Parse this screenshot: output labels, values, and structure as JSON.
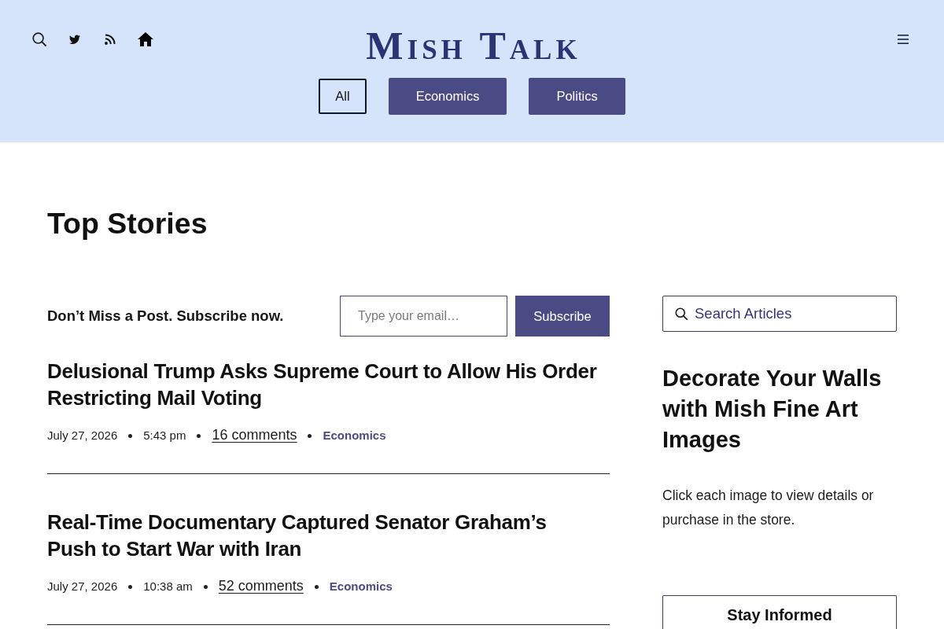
{
  "site": {
    "logo": "Mish Talk"
  },
  "nav": [
    {
      "label": "All",
      "selected": true
    },
    {
      "label": "Economics",
      "selected": false
    },
    {
      "label": "Politics",
      "selected": false
    }
  ],
  "page_title": "Top Stories",
  "subscribe": {
    "prompt": "Don’t Miss a Post. Subscribe now.",
    "placeholder": "Type your email…",
    "button": "Subscribe"
  },
  "articles": [
    {
      "title": "Delusional Trump Asks Supreme Court to Allow His Order Restricting Mail Voting",
      "date": "July 27, 2026",
      "time": "5:43 pm",
      "comments": "16 comments",
      "category": "Economics"
    },
    {
      "title": "Real-Time Documentary Captured Senator Graham’s Push to Start War with Iran",
      "date": "July 27, 2026",
      "time": "10:38 am",
      "comments": "52 comments",
      "category": "Economics"
    }
  ],
  "sidebar": {
    "search": {
      "placeholder": "Search Articles"
    },
    "promo": {
      "heading": "Decorate Your Walls with Mish Fine Art Images",
      "text": "Click each image to view details or purchase in the store."
    },
    "newsletter": {
      "heading": "Stay Informed"
    }
  }
}
